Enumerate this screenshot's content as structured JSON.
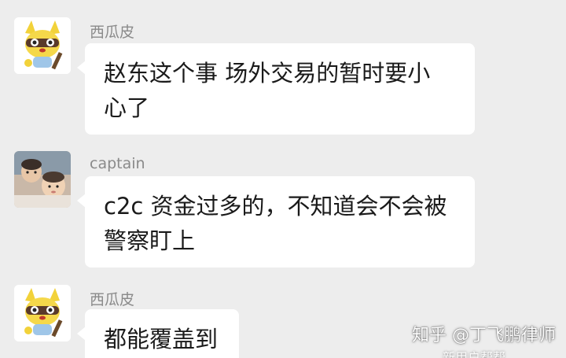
{
  "messages": [
    {
      "sender": "西瓜皮",
      "avatar_icon": "cartoon-animal-avatar-icon",
      "lines": [
        "赵东这个事 场外交易的暂时要小",
        "心了"
      ]
    },
    {
      "sender": "captain",
      "avatar_icon": "photo-avatar-icon",
      "lines": [
        "c2c 资金过多的，不知道会不会被",
        "警察盯上"
      ]
    },
    {
      "sender": "西瓜皮",
      "avatar_icon": "cartoon-animal-avatar-icon",
      "lines": [
        "都能覆盖到"
      ]
    }
  ],
  "watermark": {
    "text": "知乎 @丁飞鹏律师",
    "sub_text": "新用户帮帮"
  },
  "colors": {
    "background": "#ededed",
    "bubble": "#ffffff",
    "sender_name": "#8a8a8a",
    "message_text": "#1a1a1a"
  }
}
